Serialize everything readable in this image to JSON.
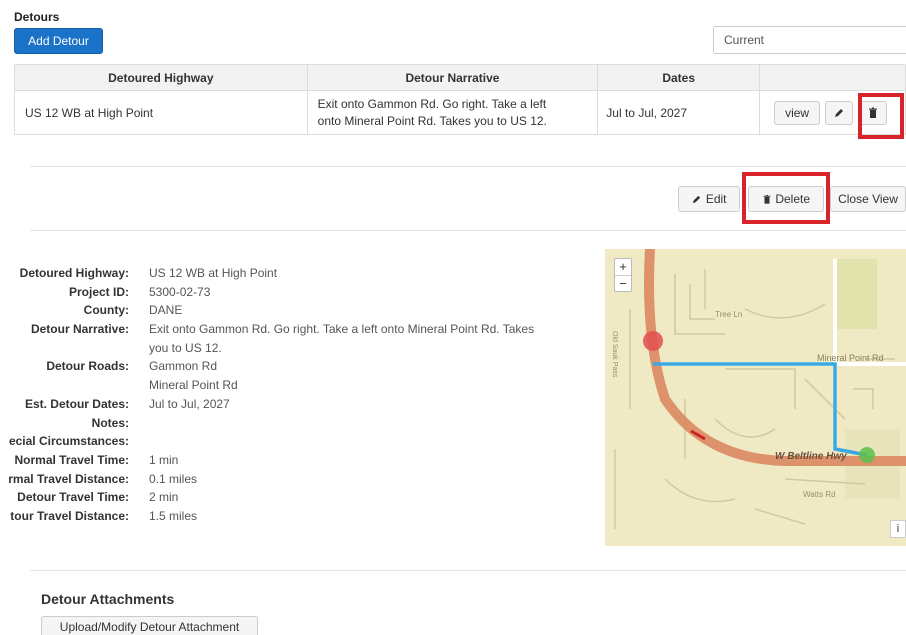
{
  "detours": {
    "title": "Detours",
    "add_button": "Add Detour",
    "filter_value": "Current",
    "columns": [
      "Detoured Highway",
      "Detour Narrative",
      "Dates"
    ],
    "rows": [
      {
        "highway": "US 12 WB at High Point",
        "narrative_line1": "Exit onto Gammon Rd. Go right. Take a left",
        "narrative_line2": "onto Mineral Point Rd. Takes you to US 12.",
        "dates": "Jul to Jul, 2027",
        "view_label": "view"
      }
    ]
  },
  "actions": {
    "edit_label": "Edit",
    "delete_label": "Delete",
    "close_label": "Close View"
  },
  "details": {
    "detoured_highway": {
      "label": "Detoured Highway:",
      "value": "US 12 WB at High Point"
    },
    "project_id": {
      "label": "Project ID:",
      "value": "5300-02-73"
    },
    "county": {
      "label": "County:",
      "value": "DANE"
    },
    "narrative": {
      "label": "Detour Narrative:",
      "line1": "Exit onto Gammon Rd. Go right. Take a left onto Mineral Point Rd. Takes",
      "line2": "you to US 12."
    },
    "roads": {
      "label": "Detour Roads:",
      "line1": "Gammon Rd",
      "line2": "Mineral Point Rd"
    },
    "est_dates": {
      "label": "Est. Detour Dates:",
      "value": "Jul to Jul, 2027"
    },
    "notes": {
      "label": "Notes:",
      "value": ""
    },
    "special": {
      "label": "ecial Circumstances:",
      "value": ""
    },
    "normal_time": {
      "label": "Normal Travel Time:",
      "value": "1 min"
    },
    "normal_distance": {
      "label": "rmal Travel Distance:",
      "value": "0.1 miles"
    },
    "detour_time": {
      "label": "Detour Travel Time:",
      "value": "2 min"
    },
    "detour_distance": {
      "label": "tour Travel Distance:",
      "value": "1.5 miles"
    }
  },
  "map": {
    "zoom_in": "+",
    "zoom_out": "−",
    "info": "i",
    "labels": {
      "tree_ln": "Tree Ln",
      "mineral_point_rd": "Mineral Point Rd",
      "w_beltline": "W Beltline Hwy",
      "watts_rd": "Watts Rd",
      "gammon_vertical": "Old Sauk Pass"
    },
    "colors": {
      "background": "#efe9c4",
      "highway": "#d9835c",
      "route": "#3aa8e0",
      "start_marker": "#e05050",
      "end_marker": "#5cc14a"
    }
  },
  "attachments": {
    "title": "Detour Attachments",
    "upload_label": "Upload/Modify Detour Attachment"
  }
}
